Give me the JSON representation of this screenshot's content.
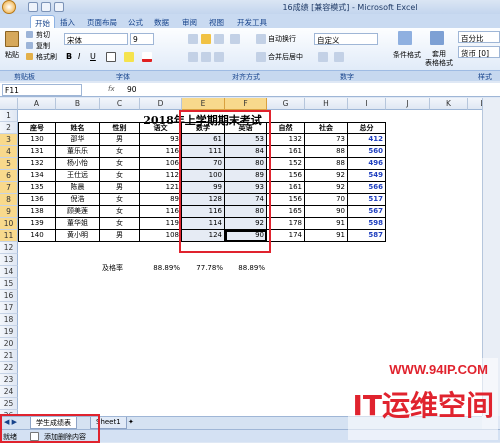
{
  "window": {
    "title": "16成绩 [兼容模式] - Microsoft Excel"
  },
  "tabs": [
    "开始",
    "插入",
    "页面布局",
    "公式",
    "数据",
    "审阅",
    "视图",
    "开发工具"
  ],
  "ribbon": {
    "paste": "粘贴",
    "cut": "剪切",
    "copy": "复制",
    "format_painter": "格式刷",
    "font_name": "宋体",
    "font_size": "9",
    "wrap": "自动换行",
    "merge": "合并后居中",
    "number_format": "自定义",
    "cond_format": "条件格式",
    "table_format": "套用\n表格格式",
    "percent": "百分比",
    "currency": "货币 [0]"
  },
  "groups": [
    "剪贴板",
    "字体",
    "对齐方式",
    "数字",
    "样式"
  ],
  "formula": {
    "name_box": "F11",
    "fx": "fx",
    "value": "90"
  },
  "columns": [
    "A",
    "B",
    "C",
    "D",
    "E",
    "F",
    "G",
    "H",
    "I",
    "J",
    "K",
    "L"
  ],
  "sheet": {
    "title": "2018年上学期期末考试",
    "headers": [
      "座号",
      "姓名",
      "性别",
      "语文",
      "数学",
      "英语",
      "自然",
      "社会",
      "总分"
    ],
    "rows": [
      [
        "130",
        "邵华",
        "男",
        "93",
        "61",
        "53",
        "132",
        "73",
        "412"
      ],
      [
        "131",
        "董乐乐",
        "女",
        "116",
        "111",
        "84",
        "161",
        "88",
        "560"
      ],
      [
        "132",
        "杨小怡",
        "女",
        "106",
        "70",
        "80",
        "152",
        "88",
        "496"
      ],
      [
        "134",
        "王仕远",
        "女",
        "112",
        "100",
        "89",
        "156",
        "92",
        "549"
      ],
      [
        "135",
        "陈晨",
        "男",
        "121",
        "99",
        "93",
        "161",
        "92",
        "566"
      ],
      [
        "136",
        "倪浩",
        "女",
        "89",
        "128",
        "74",
        "156",
        "70",
        "517"
      ],
      [
        "138",
        "顾美莲",
        "女",
        "116",
        "116",
        "80",
        "165",
        "90",
        "567"
      ],
      [
        "139",
        "董华姐",
        "女",
        "119",
        "114",
        "92",
        "178",
        "91",
        "598"
      ],
      [
        "140",
        "黄小明",
        "男",
        "108",
        "124",
        "90",
        "174",
        "91",
        "587"
      ]
    ],
    "pass_label": "及格率",
    "pass_rates": [
      "88.89%",
      "77.78%",
      "88.89%"
    ]
  },
  "sheet_tabs": [
    "学生成绩表",
    "Sheet1"
  ],
  "status": {
    "mode": "就绪",
    "hint": "添加删除内容"
  },
  "watermark": {
    "url": "WWW.94IP.COM",
    "brand": "IT运维空间"
  }
}
